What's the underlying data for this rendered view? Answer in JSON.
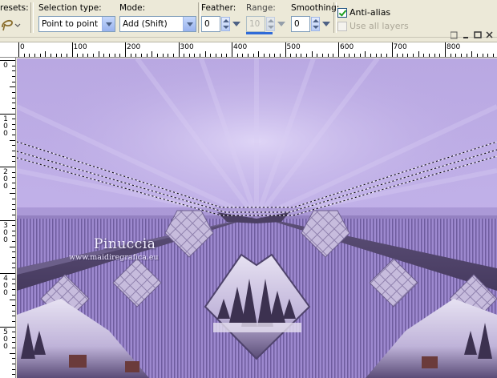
{
  "toolbar": {
    "presets_label": "resets:",
    "selection_type": {
      "label": "Selection type:",
      "value": "Point to point"
    },
    "mode": {
      "label": "Mode:",
      "value": "Add (Shift)"
    },
    "feather": {
      "label": "Feather:",
      "value": "0"
    },
    "range": {
      "label": "Range:",
      "value": "10"
    },
    "smoothing": {
      "label": "Smoothing:",
      "value": "0"
    },
    "anti_alias": {
      "label": "Anti-alias",
      "checked": true
    },
    "use_all_layers": {
      "label": "Use all layers",
      "checked": false
    }
  },
  "ruler_top": {
    "labels": [
      "0",
      "100",
      "200",
      "300",
      "400",
      "500",
      "600",
      "700",
      "800"
    ]
  },
  "ruler_left": {
    "labels": [
      "0",
      "100",
      "200",
      "300",
      "400",
      "500"
    ]
  },
  "watermark": {
    "name": "Pinuccia",
    "url": "www.maidiregrafica.eu"
  },
  "colors": {
    "canvas_bg": "#b5a4de",
    "band": "#5d5078",
    "accent": "#2f6bd8"
  }
}
